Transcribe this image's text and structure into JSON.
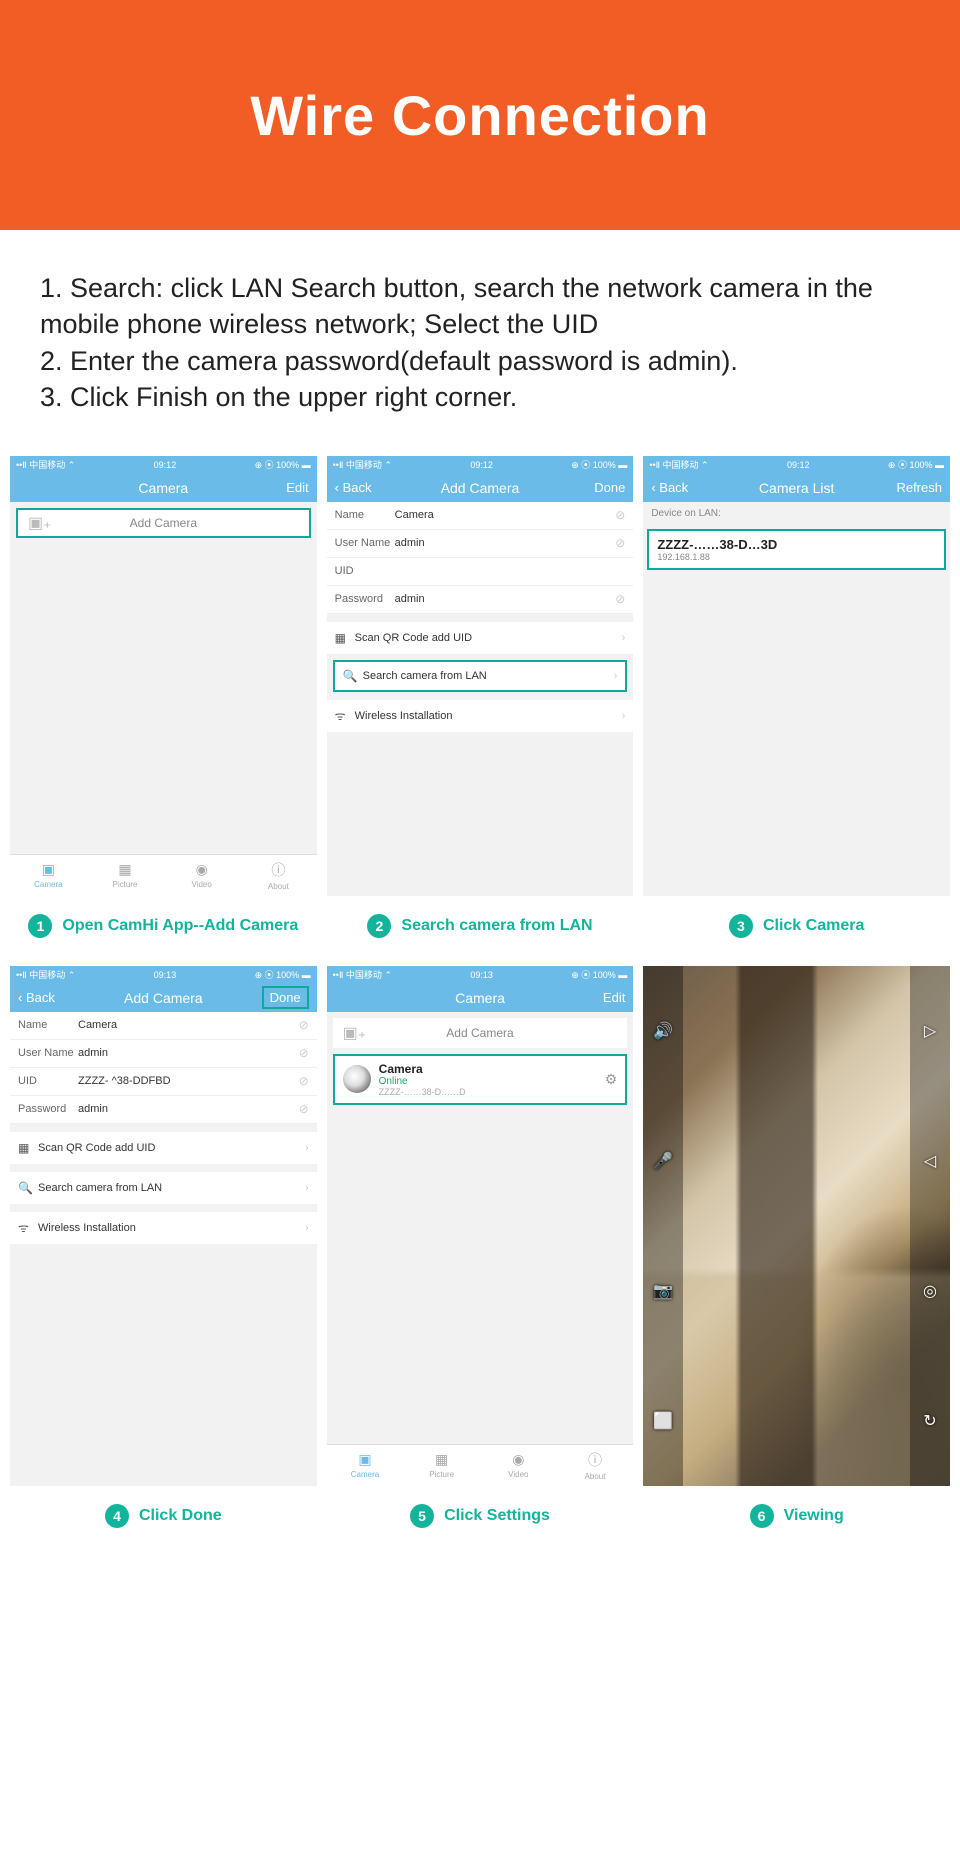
{
  "header": {
    "title": "Wire Connection"
  },
  "instructions": {
    "line1": "1. Search: click LAN Search button, search the network camera in the mobile phone wireless network; Select the UID",
    "line2": "2. Enter the camera password(default password is admin).",
    "line3": "3. Click Finish on the upper right corner."
  },
  "status_bar": {
    "carrier": "••Ⅱ 中国移动 ⌃",
    "time1": "09:12",
    "time2": "09:13",
    "right": "⊕ ⦿ 100% ▬"
  },
  "screens": {
    "s1": {
      "nav_center": "Camera",
      "nav_right": "Edit",
      "add_btn": "Add Camera",
      "tabs": [
        "Camera",
        "Picture",
        "Video",
        "About"
      ],
      "caption": "Open CamHi App--Add Camera"
    },
    "s2": {
      "nav_left": "Back",
      "nav_center": "Add Camera",
      "nav_right": "Done",
      "fields": {
        "name_lbl": "Name",
        "name_val": "Camera",
        "user_lbl": "User Name",
        "user_val": "admin",
        "uid_lbl": "UID",
        "uid_val": "",
        "pwd_lbl": "Password",
        "pwd_val": "admin"
      },
      "opt_qr": "Scan QR Code add UID",
      "opt_lan": "Search camera from LAN",
      "opt_wifi": "Wireless Installation",
      "caption": "Search camera from LAN"
    },
    "s3": {
      "nav_left": "Back",
      "nav_center": "Camera List",
      "nav_right": "Refresh",
      "subhead": "Device on LAN:",
      "device_uid": "ZZZZ-……38-D…3D",
      "device_ip": "192.168.1.88",
      "caption": "Click Camera"
    },
    "s4": {
      "nav_left": "Back",
      "nav_center": "Add Camera",
      "nav_right": "Done",
      "fields": {
        "name_lbl": "Name",
        "name_val": "Camera",
        "user_lbl": "User Name",
        "user_val": "admin",
        "uid_lbl": "UID",
        "uid_val": "ZZZZ- ^38-DDFBD",
        "pwd_lbl": "Password",
        "pwd_val": "admin"
      },
      "opt_qr": "Scan QR Code add UID",
      "opt_lan": "Search camera from LAN",
      "opt_wifi": "Wireless Installation",
      "caption": "Click Done"
    },
    "s5": {
      "nav_center": "Camera",
      "nav_right": "Edit",
      "add_btn": "Add Camera",
      "cam_name": "Camera",
      "cam_status": "Online",
      "cam_uid": "ZZZZ-……38-D……D",
      "tabs": [
        "Camera",
        "Picture",
        "Video",
        "About"
      ],
      "caption": "Click Settings"
    },
    "s6": {
      "caption": "Viewing"
    }
  },
  "badges": {
    "b1": "1",
    "b2": "2",
    "b3": "3",
    "b4": "4",
    "b5": "5",
    "b6": "6"
  }
}
